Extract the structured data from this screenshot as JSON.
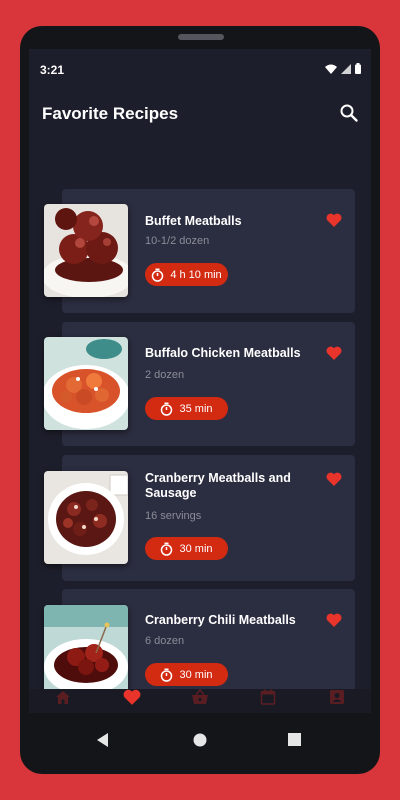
{
  "status_bar": {
    "time": "3:21"
  },
  "app_bar": {
    "title": "Favorite Recipes",
    "search_icon": "search-icon"
  },
  "recipes": [
    {
      "name": "Buffet Meatballs",
      "yield": "10-1/2 dozen",
      "time": "4 h 10 min",
      "favorite": true
    },
    {
      "name": "Buffalo Chicken Meatballs",
      "yield": "2 dozen",
      "time": "35 min",
      "favorite": true
    },
    {
      "name": "Cranberry Meatballs and Sausage",
      "yield": "16 servings",
      "time": "30 min",
      "favorite": true
    },
    {
      "name": "Cranberry Chili Meatballs",
      "yield": "6 dozen",
      "time": "30 min",
      "favorite": true
    }
  ],
  "bottom_nav": [
    {
      "icon": "home-icon",
      "active": false
    },
    {
      "icon": "heart-icon",
      "active": true
    },
    {
      "icon": "basket-icon",
      "active": false
    },
    {
      "icon": "calendar-icon",
      "active": false
    },
    {
      "icon": "profile-icon",
      "active": false
    }
  ],
  "colors": {
    "accent": "#e8342a",
    "timer_badge": "#d32a12",
    "card_background": "#2b2d40",
    "screen_background": "#1d1e2b",
    "frame": "#d8363a"
  }
}
